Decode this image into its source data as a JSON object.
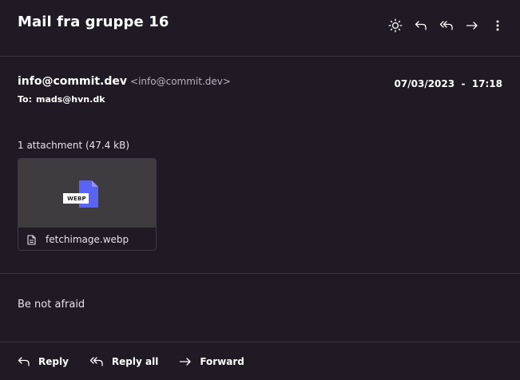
{
  "subject": "Mail fra gruppe 16",
  "toolbar": {
    "theme": "sun-icon",
    "reply": "reply-icon",
    "reply_all": "reply-all-icon",
    "forward": "forward-icon",
    "more": "more-vertical-icon"
  },
  "sender": {
    "name": "info@commit.dev",
    "email": "<info@commit.dev>"
  },
  "date": "07/03/2023  -  17:18",
  "to": {
    "label": "To:",
    "value": "mads@hvn.dk"
  },
  "attachments": {
    "count_label": "1 attachment (47.4 kB)",
    "items": [
      {
        "name": "fetchimage.webp",
        "type_badge": "WEBP",
        "file_icon": "document-icon"
      }
    ]
  },
  "body": "Be not afraid",
  "actions": {
    "reply": "Reply",
    "reply_all": "Reply all",
    "forward": "Forward"
  },
  "colors": {
    "background": "#1f1a24",
    "accent": "#5b63f5",
    "preview_bg": "#3e3c3e"
  }
}
